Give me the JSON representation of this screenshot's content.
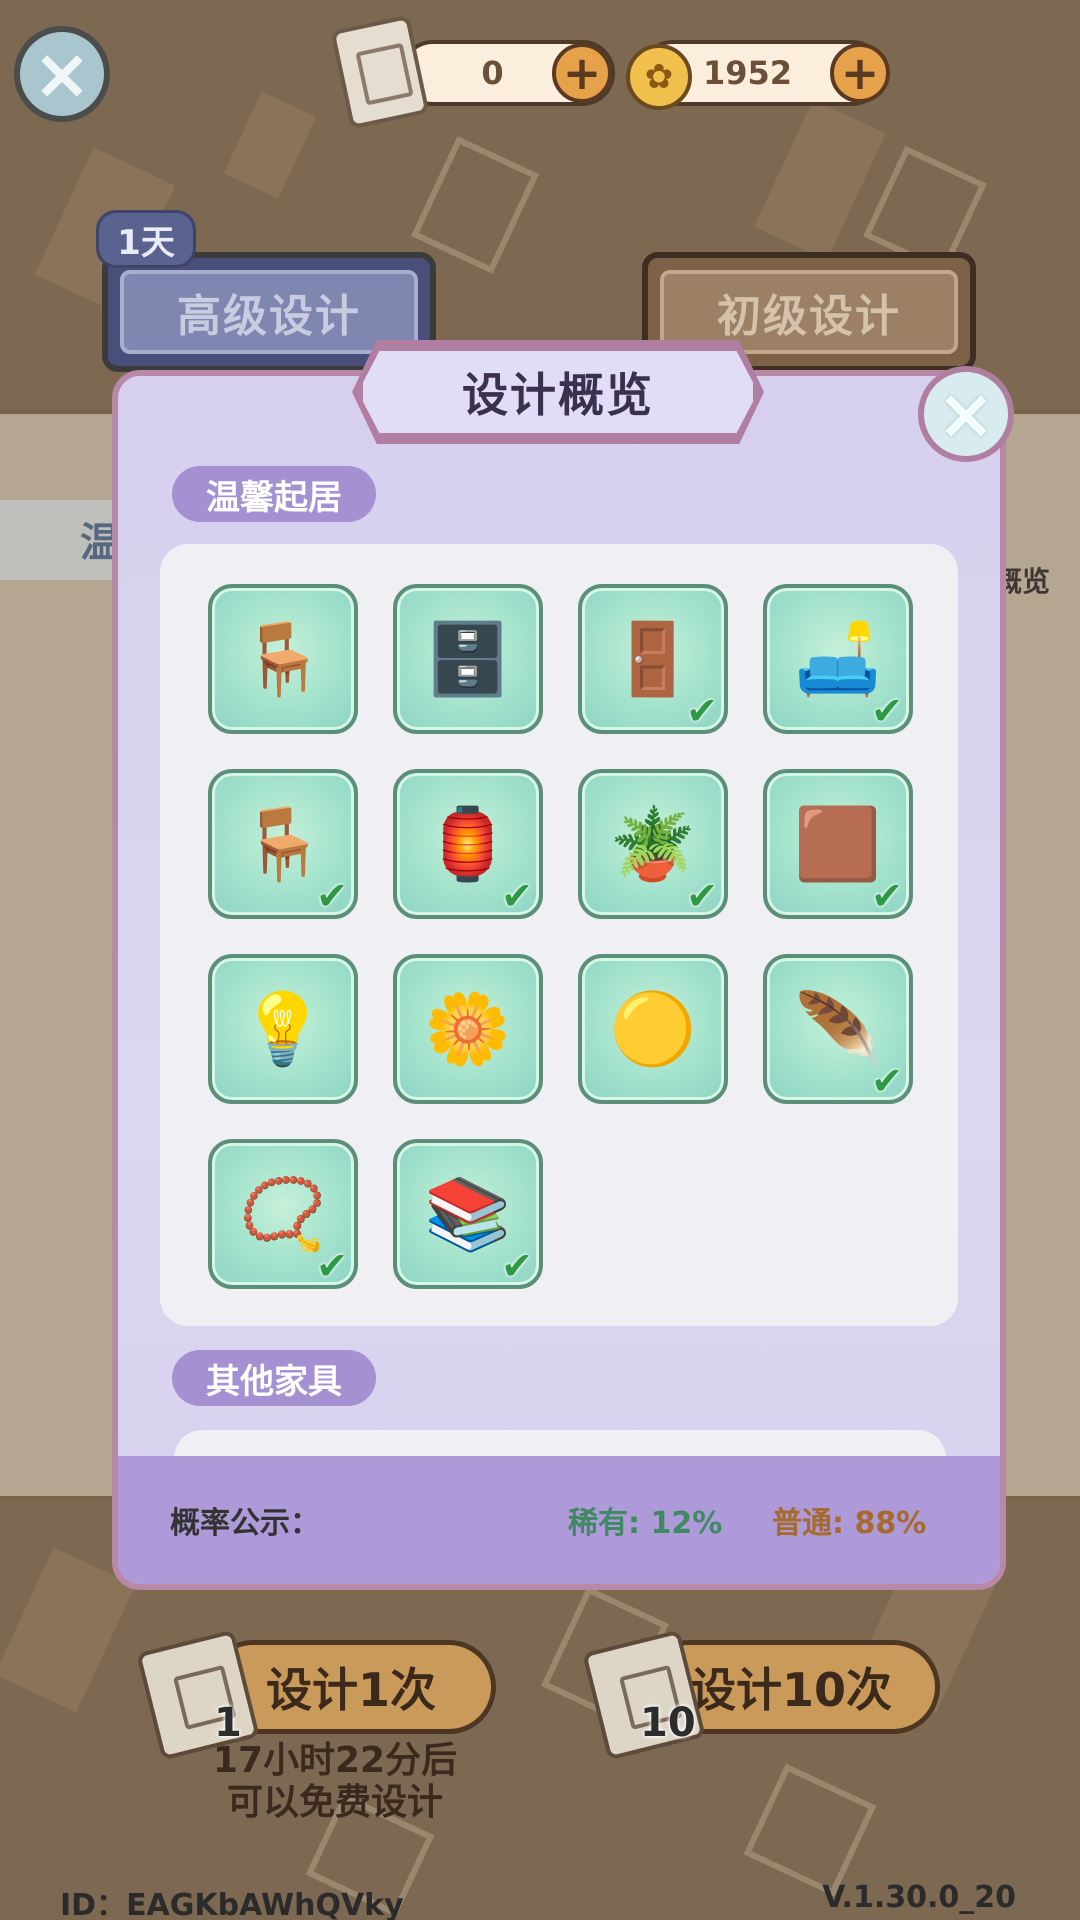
{
  "currencies": {
    "scroll": {
      "value": "0",
      "icon": "scroll-icon"
    },
    "coin": {
      "value": "1952",
      "icon": "coin-icon"
    }
  },
  "tabs": {
    "advanced": {
      "label": "高级设计",
      "badge": "1天"
    },
    "basic": {
      "label": "初级设计"
    }
  },
  "background": {
    "strip_text": "温",
    "overview_text": "概览"
  },
  "modal": {
    "title": "设计概览",
    "sections": [
      {
        "label": "温馨起居",
        "items": [
          {
            "name": "rattan-chair",
            "icon": "🪑",
            "owned": false
          },
          {
            "name": "wooden-cabinet",
            "icon": "🗄️",
            "owned": false
          },
          {
            "name": "tall-cupboard",
            "icon": "🚪",
            "owned": true
          },
          {
            "name": "cushioned-bench",
            "icon": "🛋️",
            "owned": true
          },
          {
            "name": "bar-stool",
            "icon": "🪑",
            "owned": true
          },
          {
            "name": "hanging-lamp",
            "icon": "🏮",
            "owned": true
          },
          {
            "name": "vase-branch",
            "icon": "🪴",
            "owned": true
          },
          {
            "name": "wooden-table",
            "icon": "🟫",
            "owned": true
          },
          {
            "name": "table-lamp",
            "icon": "💡",
            "owned": false
          },
          {
            "name": "flower-bouquet",
            "icon": "🌼",
            "owned": false
          },
          {
            "name": "round-rug",
            "icon": "🟡",
            "owned": false
          },
          {
            "name": "wall-hanging",
            "icon": "🪶",
            "owned": true
          },
          {
            "name": "bead-curtain",
            "icon": "📿",
            "owned": true
          },
          {
            "name": "vine-shelf",
            "icon": "📚",
            "owned": true
          }
        ]
      },
      {
        "label": "其他家具"
      }
    ],
    "probability": {
      "label": "概率公示：",
      "rare": "稀有: 12%",
      "common": "普通: 88%"
    }
  },
  "actions": {
    "draw_one": {
      "label": "设计1次",
      "cost": "1"
    },
    "draw_ten": {
      "label": "设计10次",
      "cost": "10"
    },
    "free_timer": "17小时22分后\n可以免费设计"
  },
  "footer": {
    "id": "ID：EAGKbAWhQVky",
    "version": "V.1.30.0_20"
  }
}
